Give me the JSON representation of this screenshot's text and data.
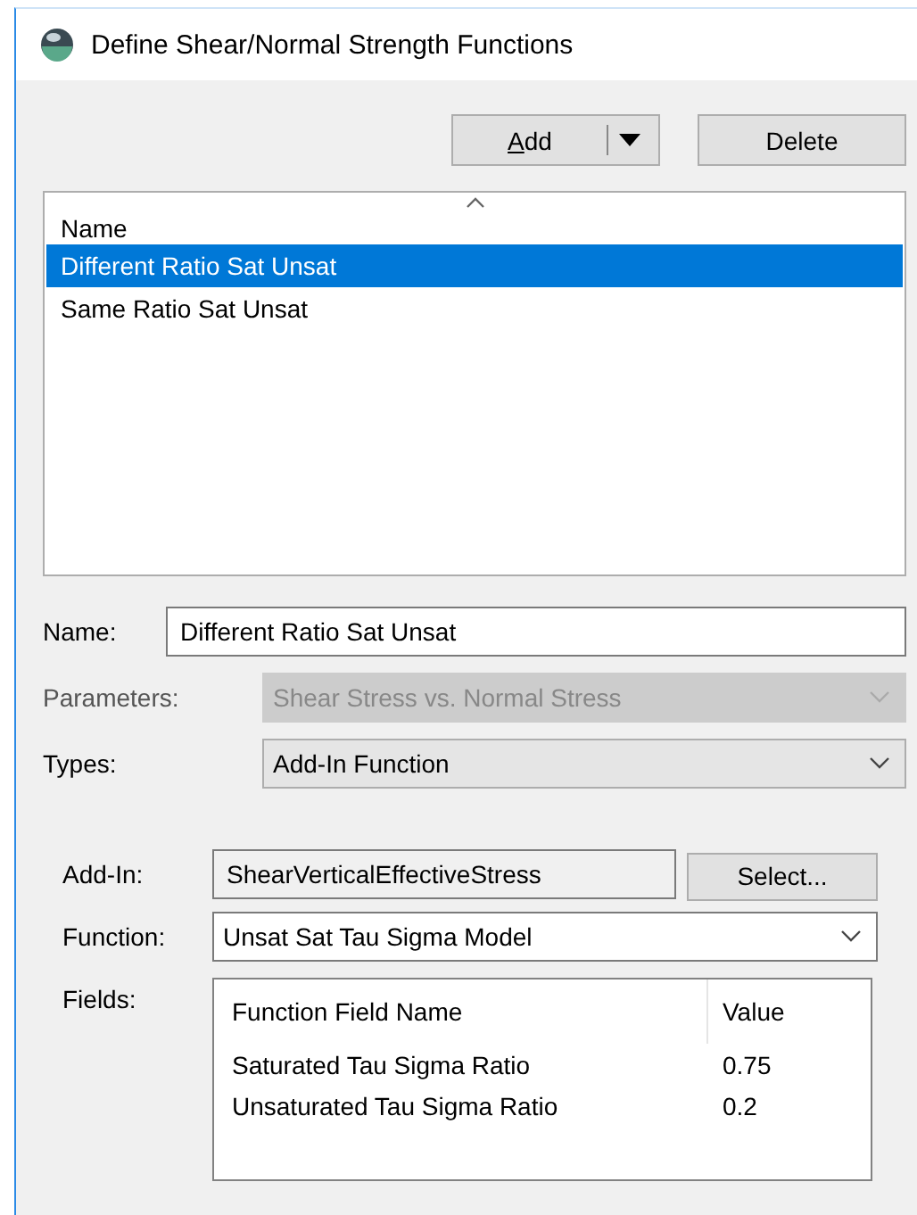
{
  "window": {
    "title": "Define Shear/Normal Strength Functions"
  },
  "toolbar": {
    "buttons": [
      {
        "kind": "split",
        "label": "Add",
        "access_key_underlined": true
      },
      {
        "kind": "plain",
        "label": "Delete"
      }
    ]
  },
  "function_list": {
    "column": {
      "label": "Name",
      "sorted": true
    },
    "items": [
      {
        "label": "Different Ratio Sat Unsat",
        "selected": true
      },
      {
        "label": "Same Ratio Sat Unsat",
        "selected": false
      }
    ]
  },
  "form": [
    {
      "kind": "text",
      "label": "Name:",
      "value": "Different Ratio Sat Unsat",
      "disabled": false
    },
    {
      "kind": "combo",
      "label": "Parameters:",
      "value": "Shear Stress vs. Normal Stress",
      "disabled": true
    },
    {
      "kind": "combo",
      "label": "Types:",
      "value": "Add-In Function",
      "disabled": false
    }
  ],
  "add_in": {
    "label": "Add-In:",
    "value": "ShearVerticalEffectiveStress",
    "button": "Select..."
  },
  "function": {
    "label": "Function:",
    "value": "Unsat Sat Tau Sigma Model"
  },
  "fields": {
    "label": "Fields:",
    "columns": [
      "Function Field Name",
      "Value"
    ],
    "rows": [
      [
        "Saturated Tau Sigma Ratio",
        "0.75"
      ],
      [
        "Unsaturated Tau Sigma Ratio",
        "0.2"
      ]
    ]
  }
}
